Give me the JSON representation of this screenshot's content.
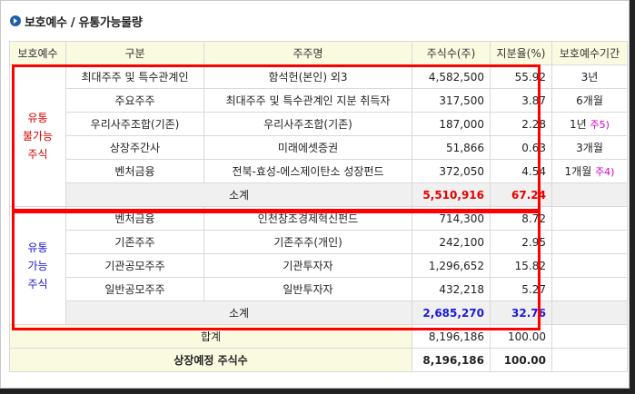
{
  "title": "보호예수 / 유통가능물량",
  "headers": [
    "보호예수",
    "구분",
    "주주명",
    "주식수(주)",
    "지분율(%)",
    "보호예수기간"
  ],
  "lock_group": {
    "label_lines": [
      "유통",
      "불가능",
      "주식"
    ],
    "rows": [
      {
        "category": "최대주주 및 특수관계인",
        "holder": "함석헌(본인) 외3",
        "shares": "4,582,500",
        "ratio": "55.92",
        "period": "3년",
        "note": ""
      },
      {
        "category": "주요주주",
        "holder": "최대주주 및 특수관계인 지분 취득자",
        "shares": "317,500",
        "ratio": "3.87",
        "period": "6개월",
        "note": ""
      },
      {
        "category": "우리사주조합(기존)",
        "holder": "우리사주조합(기존)",
        "shares": "187,000",
        "ratio": "2.28",
        "period": "1년",
        "note": "주5)"
      },
      {
        "category": "상장주간사",
        "holder": "미래에셋증권",
        "shares": "51,866",
        "ratio": "0.63",
        "period": "3개월",
        "note": ""
      },
      {
        "category": "벤처금융",
        "holder": "전북-효성-에스제이탄소 성장펀드",
        "shares": "372,050",
        "ratio": "4.54",
        "period": "1개월",
        "note": "주4)"
      }
    ],
    "subtotal": {
      "label": "소계",
      "shares": "5,510,916",
      "ratio": "67.24"
    }
  },
  "free_group": {
    "label_lines": [
      "유통",
      "가능",
      "주식"
    ],
    "rows": [
      {
        "category": "벤처금융",
        "holder": "인천창조경제혁신펀드",
        "shares": "714,300",
        "ratio": "8.72"
      },
      {
        "category": "기존주주",
        "holder": "기존주주(개인)",
        "shares": "242,100",
        "ratio": "2.95"
      },
      {
        "category": "기관공모주주",
        "holder": "기관투자자",
        "shares": "1,296,652",
        "ratio": "15.82"
      },
      {
        "category": "일반공모주주",
        "holder": "일반투자자",
        "shares": "432,218",
        "ratio": "5.27"
      }
    ],
    "subtotal": {
      "label": "소계",
      "shares": "2,685,270",
      "ratio": "32.76"
    }
  },
  "total": {
    "label": "합계",
    "shares": "8,196,186",
    "ratio": "100.00"
  },
  "listed_total": {
    "label": "상장예정 주식수",
    "shares": "8,196,186",
    "ratio": "100.00"
  },
  "colors": {
    "header_bg": "#fafae1",
    "subtotal_bg": "#f0f0f0",
    "lock_red": "#e60000",
    "free_blue": "#1a1adb",
    "highlight_border": "#ff0000"
  }
}
